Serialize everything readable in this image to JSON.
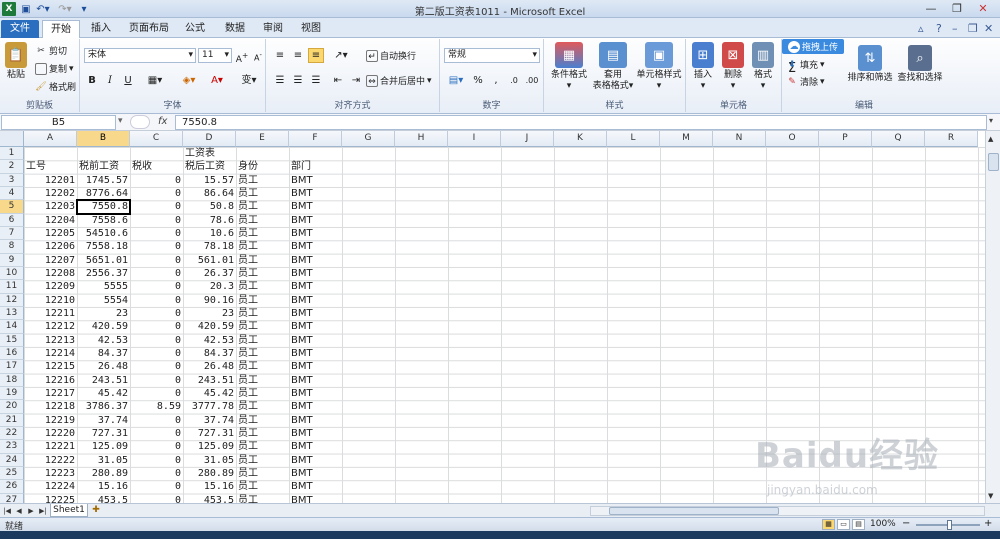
{
  "titlebar": {
    "app_icon": "X",
    "qat_icons": [
      "save-icon",
      "undo-icon",
      "redo-icon",
      "customize-icon"
    ],
    "title": "第二版工资表1011 - Microsoft Excel"
  },
  "tabs": {
    "file": "文件",
    "items": [
      "开始",
      "插入",
      "页面布局",
      "公式",
      "数据",
      "审阅",
      "视图"
    ],
    "active": "开始"
  },
  "ribbon": {
    "clipboard": {
      "label": "剪贴板",
      "paste": "粘贴",
      "cut": "剪切",
      "copy": "复制",
      "format_painter": "格式刷"
    },
    "font": {
      "label": "字体",
      "family": "宋体",
      "size": "11",
      "bold": "B",
      "italic": "I",
      "underline": "U"
    },
    "alignment": {
      "label": "对齐方式",
      "wrap": "自动换行",
      "merge": "合并后居中"
    },
    "number": {
      "label": "数字",
      "format": "常规",
      "percent": "%",
      "comma": ","
    },
    "styles": {
      "label": "样式",
      "conditional": "条件格式",
      "table_line1": "套用",
      "table_line2": "表格格式",
      "cell_styles": "单元格样式"
    },
    "cells": {
      "label": "单元格",
      "insert": "插入",
      "delete": "删除",
      "format": "格式"
    },
    "editing": {
      "label": "编辑",
      "upload": "拖拽上传",
      "fill": "填充",
      "clear": "清除",
      "sort": "排序和筛选",
      "find": "查找和选择",
      "sum": "Σ"
    }
  },
  "formula_bar": {
    "name_box": "B5",
    "fx": "fx",
    "formula": "7550.8"
  },
  "columns": [
    "A",
    "B",
    "C",
    "D",
    "E",
    "F",
    "G",
    "H",
    "I",
    "J",
    "K",
    "L",
    "M",
    "N",
    "O",
    "P",
    "Q",
    "R"
  ],
  "selected_column": "B",
  "selected_row": "5",
  "rows": [
    "1",
    "2",
    "3",
    "4",
    "5",
    "6",
    "7",
    "8",
    "9",
    "10",
    "11",
    "12",
    "13",
    "14",
    "15",
    "16",
    "17",
    "18",
    "19",
    "20",
    "21",
    "22",
    "23",
    "24",
    "25",
    "26",
    "27"
  ],
  "sheet": {
    "title_cell": "工资表",
    "headers": [
      "工号",
      "税前工资",
      "税收",
      "税后工资",
      "身份",
      "部门"
    ],
    "data": [
      [
        "12201",
        "1745.57",
        "0",
        "15.57",
        "员工",
        "BMT"
      ],
      [
        "12202",
        "8776.64",
        "0",
        "86.64",
        "员工",
        "BMT"
      ],
      [
        "12203",
        "7550.8",
        "0",
        "50.8",
        "员工",
        "BMT"
      ],
      [
        "12204",
        "7558.6",
        "0",
        "78.6",
        "员工",
        "BMT"
      ],
      [
        "12205",
        "54510.6",
        "0",
        "10.6",
        "员工",
        "BMT"
      ],
      [
        "12206",
        "7558.18",
        "0",
        "78.18",
        "员工",
        "BMT"
      ],
      [
        "12207",
        "5651.01",
        "0",
        "561.01",
        "员工",
        "BMT"
      ],
      [
        "12208",
        "2556.37",
        "0",
        "26.37",
        "员工",
        "BMT"
      ],
      [
        "12209",
        "5555",
        "0",
        "20.3",
        "员工",
        "BMT"
      ],
      [
        "12210",
        "5554",
        "0",
        "90.16",
        "员工",
        "BMT"
      ],
      [
        "12211",
        "23",
        "0",
        "23",
        "员工",
        "BMT"
      ],
      [
        "12212",
        "420.59",
        "0",
        "420.59",
        "员工",
        "BMT"
      ],
      [
        "12213",
        "42.53",
        "0",
        "42.53",
        "员工",
        "BMT"
      ],
      [
        "12214",
        "84.37",
        "0",
        "84.37",
        "员工",
        "BMT"
      ],
      [
        "12215",
        "26.48",
        "0",
        "26.48",
        "员工",
        "BMT"
      ],
      [
        "12216",
        "243.51",
        "0",
        "243.51",
        "员工",
        "BMT"
      ],
      [
        "12217",
        "45.42",
        "0",
        "45.42",
        "员工",
        "BMT"
      ],
      [
        "12218",
        "3786.37",
        "8.59",
        "3777.78",
        "员工",
        "BMT"
      ],
      [
        "12219",
        "37.74",
        "0",
        "37.74",
        "员工",
        "BMT"
      ],
      [
        "12220",
        "727.31",
        "0",
        "727.31",
        "员工",
        "BMT"
      ],
      [
        "12221",
        "125.09",
        "0",
        "125.09",
        "员工",
        "BMT"
      ],
      [
        "12222",
        "31.05",
        "0",
        "31.05",
        "员工",
        "BMT"
      ],
      [
        "12223",
        "280.89",
        "0",
        "280.89",
        "员工",
        "BMT"
      ],
      [
        "12224",
        "15.16",
        "0",
        "15.16",
        "员工",
        "BMT"
      ],
      [
        "12225",
        "453.5",
        "0",
        "453.5",
        "员工",
        "BMT"
      ]
    ]
  },
  "sheet_tab": "Sheet1",
  "status": {
    "ready": "就绪",
    "zoom": "100%",
    "zoom_out": "−",
    "zoom_in": "+"
  },
  "watermark": {
    "logo": "Baidu经验",
    "url": "jingyan.baidu.com"
  }
}
